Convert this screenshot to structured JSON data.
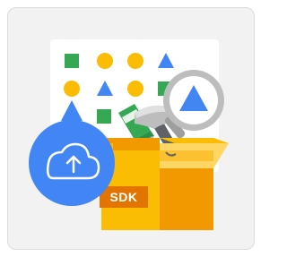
{
  "badge": {
    "label": "SDK"
  },
  "icons": {
    "panel": "shapes-grid-panel",
    "magnifier": "magnifying-glass-icon",
    "cloud": "cloud-upload-icon",
    "box": "open-box-icon",
    "hammer": "hammer-icon",
    "screwdriver": "screwdriver-icon"
  },
  "colors": {
    "card_bg": "#f2f2f2",
    "green": "#34a853",
    "yellow": "#fbbc04",
    "blue": "#4285f4",
    "box": "#fbbc04",
    "box_dark": "#f29900",
    "label": "#e37400"
  }
}
